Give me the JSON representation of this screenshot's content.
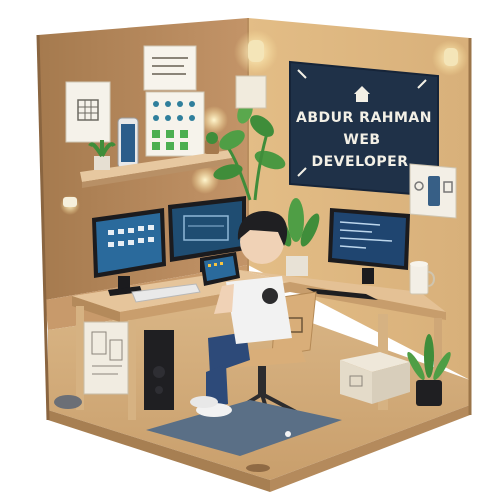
{
  "scene": {
    "description_free": true,
    "sign": {
      "line1": "ABDUR RAHMAN",
      "line2": "WEB",
      "line3": "DEVELOPER",
      "icon": "home-icon"
    },
    "colors": {
      "cork": "#b9885a",
      "wall": "#d8b584",
      "floor": "#d2ad7c",
      "desk": "#e2c196",
      "sign_bg": "#1f3148",
      "sign_text": "#f3f0e6",
      "screen": "#1d4f78",
      "shirt": "#f2f2f2",
      "jeans": "#2d4a79",
      "chair": "#d6ad7a",
      "rug": "#5a6f86",
      "plant": "#3f8d3a"
    }
  }
}
